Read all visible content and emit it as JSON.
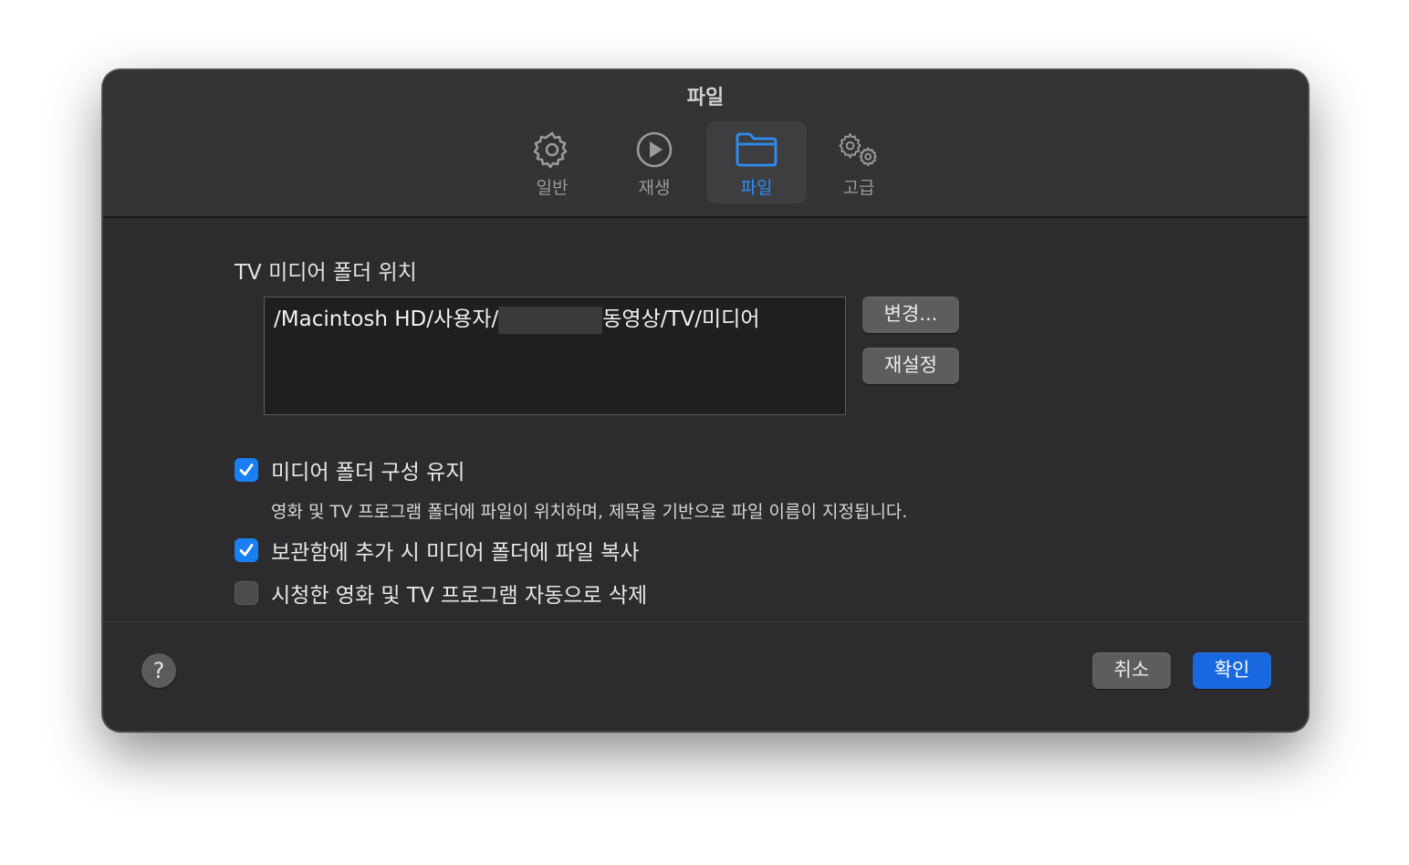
{
  "window": {
    "title": "파일"
  },
  "toolbar": {
    "tabs": [
      {
        "label": "일반",
        "icon": "gear-icon"
      },
      {
        "label": "재생",
        "icon": "play-circle-icon"
      },
      {
        "label": "파일",
        "icon": "folder-icon",
        "active": true
      },
      {
        "label": "고급",
        "icon": "gears-icon"
      }
    ]
  },
  "media_folder": {
    "section_title": "TV 미디어 폴더 위치",
    "path_prefix": "/Macintosh HD/사용자/",
    "path_suffix": "동영상/TV/미디어",
    "change_button": "변경...",
    "reset_button": "재설정"
  },
  "options": [
    {
      "label": "미디어 폴더 구성 유지",
      "checked": true
    },
    {
      "label": "보관함에 추가 시 미디어 폴더에 파일 복사",
      "checked": true
    },
    {
      "label": "시청한 영화 및 TV 프로그램 자동으로 삭제",
      "checked": false
    }
  ],
  "option_description": "영화 및 TV 프로그램 폴더에 파일이 위치하며, 제목을 기반으로 파일 이름이 지정됩니다.",
  "footer": {
    "help": "?",
    "cancel": "취소",
    "ok": "확인"
  },
  "colors": {
    "accent": "#1a7ff3",
    "active_tab": "#2e8cf0",
    "background": "#2c2c2e"
  }
}
